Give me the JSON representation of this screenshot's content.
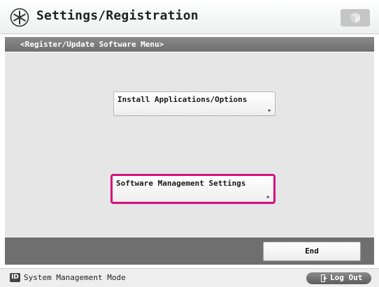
{
  "header": {
    "title": "Settings/Registration",
    "icon": "settings-asterisk-icon",
    "cube_icon": "cube-icon"
  },
  "breadcrumb": {
    "text": "<Register/Update Software Menu>"
  },
  "menu": {
    "items": [
      {
        "label": "Install Applications/Options",
        "icon": "arrow-right-icon"
      },
      {
        "label": "Software Management Settings",
        "icon": "arrow-right-icon",
        "selected": true
      }
    ]
  },
  "actions": {
    "end_label": "End"
  },
  "status": {
    "badge": "ID",
    "mode": "System Management Mode",
    "logout_label": "Log Out",
    "logout_icon": "logout-door-icon"
  },
  "colors": {
    "selection_border": "#d3127e",
    "bar_gray": "#6f6f6f",
    "main_bg": "#e6e6e6"
  }
}
